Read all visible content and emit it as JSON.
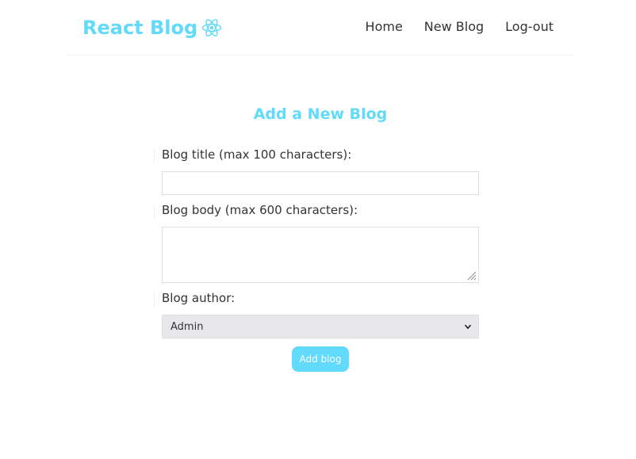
{
  "navbar": {
    "logo_text": "React Blog",
    "logo_icon": "react-atom-icon",
    "links": [
      {
        "label": "Home"
      },
      {
        "label": "New Blog"
      },
      {
        "label": "Log-out"
      }
    ]
  },
  "form": {
    "heading": "Add a New Blog",
    "title_label": "Blog title (max 100 characters):",
    "title_value": "",
    "body_label": "Blog body (max 600 characters):",
    "body_value": "",
    "author_label": "Blog author:",
    "author_selected": "Admin",
    "submit_label": "Add blog"
  },
  "colors": {
    "accent": "#61dafb",
    "text": "#333333",
    "select_bg": "#e8e8ec"
  }
}
